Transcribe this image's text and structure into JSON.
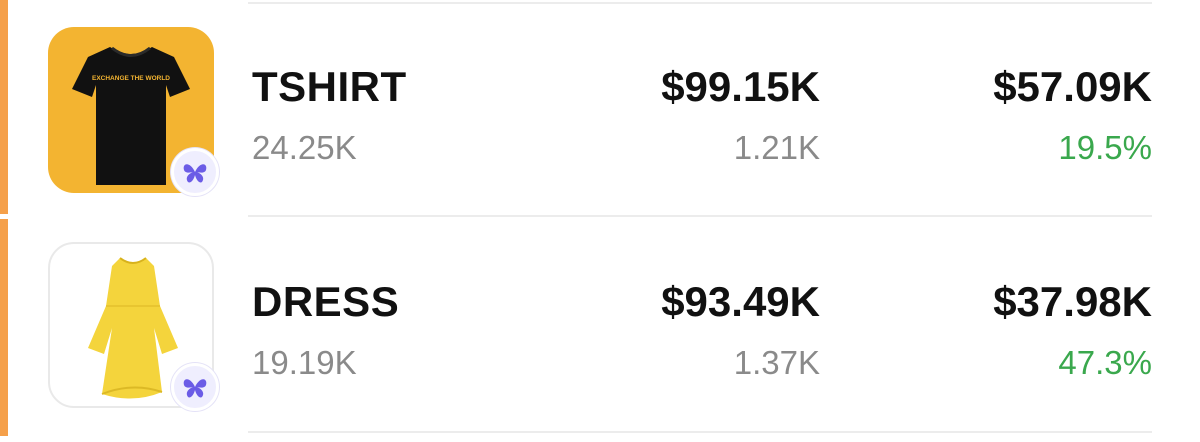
{
  "products": [
    {
      "name": "TSHIRT",
      "quantity": "24.25K",
      "revenue": "$99.15K",
      "orders": "1.21K",
      "profit": "$57.09K",
      "margin": "19.5%",
      "image_icon": "tshirt-image",
      "shirt_print": "EXCHANGE THE WORLD",
      "badge_icon": "butterfly-icon"
    },
    {
      "name": "DRESS",
      "quantity": "19.19K",
      "revenue": "$93.49K",
      "orders": "1.37K",
      "profit": "$37.98K",
      "margin": "47.3%",
      "image_icon": "dress-image",
      "badge_icon": "butterfly-icon"
    }
  ],
  "colors": {
    "accent": "#f5a04a",
    "positive": "#3aa84d",
    "badge": "#6b5ce6",
    "tshirt_bg": "#f3b431",
    "dress": "#f4d43c"
  }
}
